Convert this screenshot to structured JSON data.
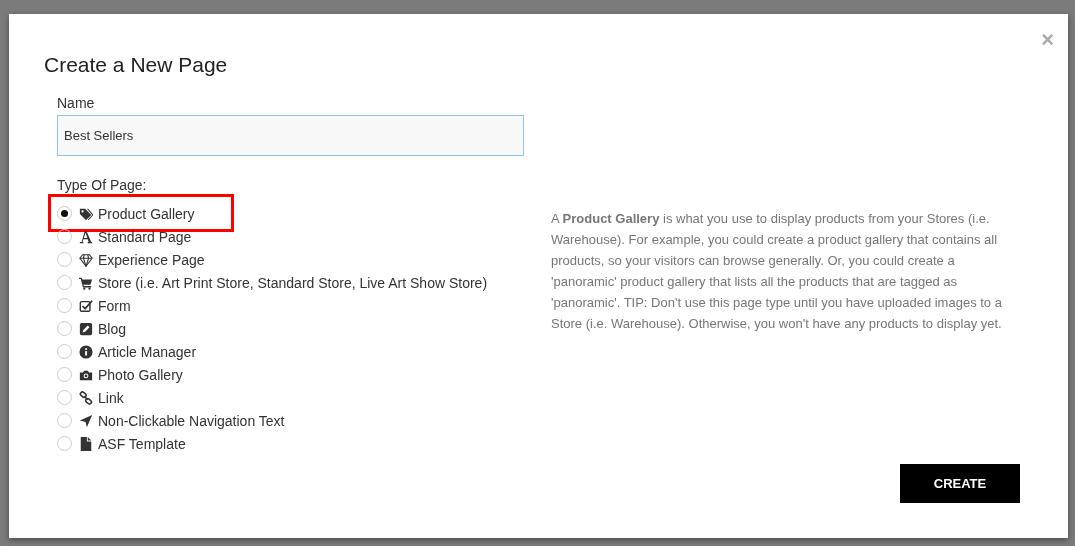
{
  "dialog": {
    "title": "Create a New Page",
    "close": "×",
    "name_field": {
      "label": "Name",
      "value": "Best Sellers"
    },
    "type_label": "Type Of Page:",
    "options": [
      {
        "kind": "tags",
        "label": "Product Gallery",
        "selected": true,
        "highlighted": true
      },
      {
        "kind": "font",
        "label": "Standard Page",
        "selected": false,
        "highlighted": false
      },
      {
        "kind": "diamond",
        "label": "Experience Page",
        "selected": false,
        "highlighted": false
      },
      {
        "kind": "cart",
        "label": "Store (i.e. Art Print Store, Standard Store, Live Art Show Store)",
        "selected": false,
        "highlighted": false
      },
      {
        "kind": "check",
        "label": "Form",
        "selected": false,
        "highlighted": false
      },
      {
        "kind": "edit",
        "label": "Blog",
        "selected": false,
        "highlighted": false
      },
      {
        "kind": "info",
        "label": "Article Manager",
        "selected": false,
        "highlighted": false
      },
      {
        "kind": "camera",
        "label": "Photo Gallery",
        "selected": false,
        "highlighted": false
      },
      {
        "kind": "link",
        "label": "Link",
        "selected": false,
        "highlighted": false
      },
      {
        "kind": "arrow",
        "label": "Non-Clickable Navigation Text",
        "selected": false,
        "highlighted": false
      },
      {
        "kind": "file",
        "label": "ASF Template",
        "selected": false,
        "highlighted": false
      }
    ],
    "description": "A **Product Gallery** is what you use to display products from your Stores (i.e. Warehouse). For example, you could create a product gallery that contains all products, so your visitors can browse generally. Or, you could create a 'panoramic' product gallery that lists all the products that are tagged as 'panoramic'. TIP: Don't use this page type until you have uploaded images to a Store (i.e. Warehouse). Otherwise, you won't have any products to display yet.",
    "create_button": "CREATE"
  }
}
